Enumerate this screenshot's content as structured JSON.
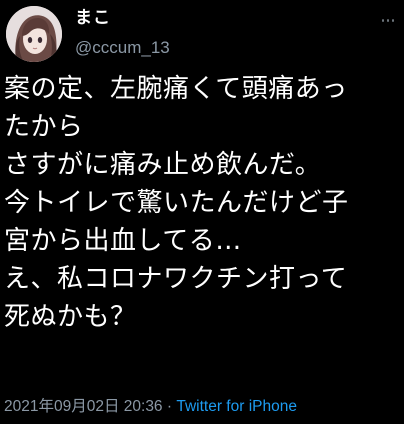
{
  "user": {
    "display_name": "まこ",
    "username": "@cccum_13"
  },
  "tweet": {
    "text": "案の定、左腕痛くて頭痛あっ\nたから\nさすがに痛み止め飲んだ。\n今トイレで驚いたんだけど子\n宮から出血してる…\nえ、私コロナワクチン打って\n死ぬかも？",
    "date": "2021年09月02日 20:36",
    "separator": " · ",
    "source": "Twitter for iPhone"
  },
  "icons": {
    "more": "more-dots-icon",
    "avatar": "avatar-illustration"
  },
  "colors": {
    "background": "#000000",
    "text": "#ffffff",
    "secondary": "#8b98a5",
    "link": "#1d9bf0"
  }
}
